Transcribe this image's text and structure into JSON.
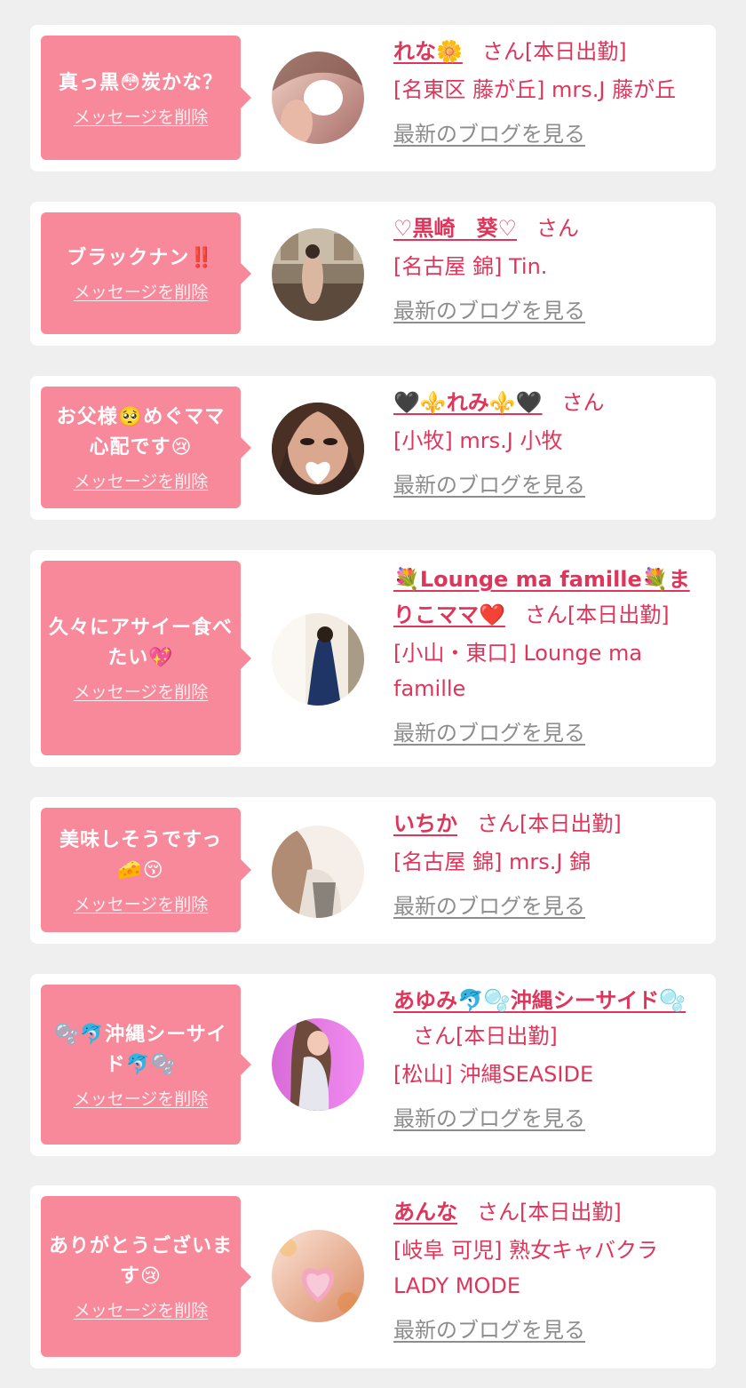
{
  "delete_label": "メッセージを削除",
  "blog_label": "最新のブログを見る",
  "san_label": "さん",
  "cards": [
    {
      "message": "真っ黒😳炭かな？",
      "name": "れな🌼",
      "status": "[本日出勤]",
      "shop": "[名東区 藤が丘] mrs.J 藤が丘"
    },
    {
      "message": "ブラックナン‼️",
      "name": "♡黒崎　葵♡",
      "status": "",
      "shop": "[名古屋 錦] Tin."
    },
    {
      "message": "お父様🥺めぐママ心配です😢",
      "name": "🖤⚜️れみ⚜️🖤",
      "status": "",
      "shop": "[小牧] mrs.J 小牧"
    },
    {
      "message": "久々にアサイー食べたい💖",
      "name": "💐Lounge ma famille💐まりこママ❤️",
      "status": "[本日出勤]",
      "shop": "[小山・東口] Lounge ma famille"
    },
    {
      "message": "美味しそうですっ🧀😚",
      "name": "いちか",
      "status": "[本日出勤]",
      "shop": "[名古屋 錦] mrs.J 錦"
    },
    {
      "message": "🫧🐬沖縄シーサイド🐬🫧",
      "name": "あゆみ🐬🫧沖縄シーサイド🫧",
      "status": "[本日出勤]",
      "shop": "[松山] 沖縄SEASIDE"
    },
    {
      "message": "ありがとうございます😢",
      "name": "あんな",
      "status": "[本日出勤]",
      "shop": "[岐阜 可児] 熟女キャバクラLADY MODE"
    }
  ]
}
